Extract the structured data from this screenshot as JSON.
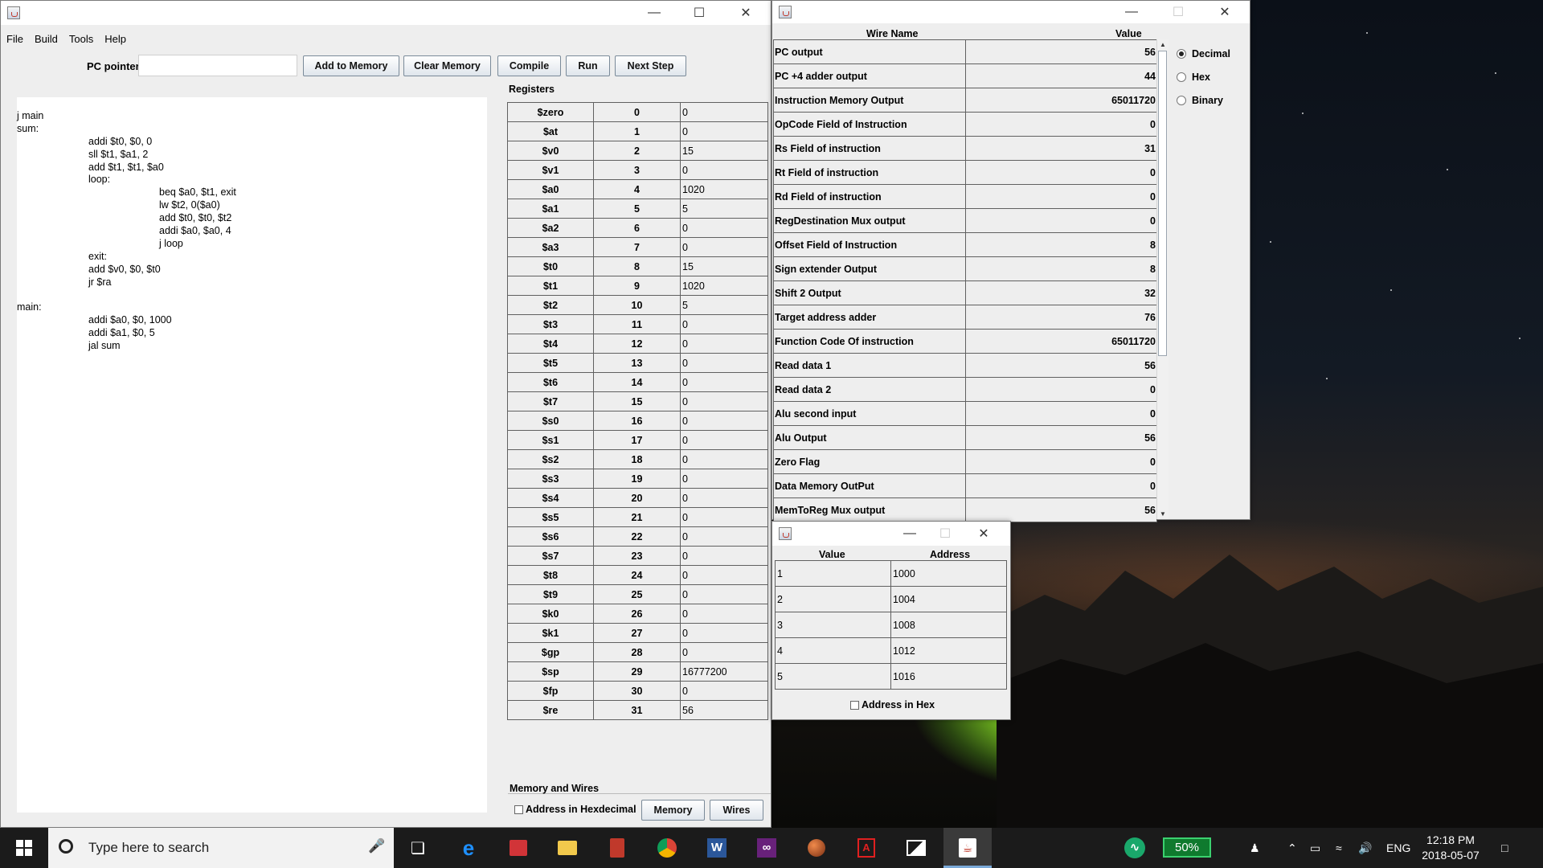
{
  "main_window": {
    "menu": [
      "File",
      "Build",
      "Tools",
      "Help"
    ],
    "pc_pointer_label": "PC pointer",
    "pc_pointer_value": "",
    "buttons": {
      "add_to_memory": "Add to Memory",
      "clear_memory": "Clear Memory",
      "compile": "Compile",
      "run": "Run",
      "next_step": "Next Step"
    },
    "code_lines": [
      {
        "indent": 0,
        "text": "j main"
      },
      {
        "indent": 0,
        "text": "sum:"
      },
      {
        "indent": 1,
        "text": "addi $t0, $0, 0"
      },
      {
        "indent": 1,
        "text": "sll $t1, $a1, 2"
      },
      {
        "indent": 1,
        "text": "add $t1, $t1, $a0"
      },
      {
        "indent": 1,
        "text": "loop:"
      },
      {
        "indent": 2,
        "text": "beq $a0, $t1, exit"
      },
      {
        "indent": 2,
        "text": "lw $t2, 0($a0)"
      },
      {
        "indent": 2,
        "text": "add $t0, $t0, $t2"
      },
      {
        "indent": 2,
        "text": "addi $a0, $a0, 4"
      },
      {
        "indent": 2,
        "text": "j loop"
      },
      {
        "indent": 1,
        "text": "exit:"
      },
      {
        "indent": 1,
        "text": "add $v0, $0, $t0"
      },
      {
        "indent": 1,
        "text": "jr $ra"
      },
      {
        "indent": 0,
        "text": ""
      },
      {
        "indent": 0,
        "text": "main:"
      },
      {
        "indent": 1,
        "text": "addi $a0, $0, 1000"
      },
      {
        "indent": 1,
        "text": "addi $a1, $0, 5"
      },
      {
        "indent": 1,
        "text": "jal sum"
      }
    ],
    "registers_label": "Registers",
    "registers": [
      [
        "$zero",
        "0",
        "0"
      ],
      [
        "$at",
        "1",
        "0"
      ],
      [
        "$v0",
        "2",
        "15"
      ],
      [
        "$v1",
        "3",
        "0"
      ],
      [
        "$a0",
        "4",
        "1020"
      ],
      [
        "$a1",
        "5",
        "5"
      ],
      [
        "$a2",
        "6",
        "0"
      ],
      [
        "$a3",
        "7",
        "0"
      ],
      [
        "$t0",
        "8",
        "15"
      ],
      [
        "$t1",
        "9",
        "1020"
      ],
      [
        "$t2",
        "10",
        "5"
      ],
      [
        "$t3",
        "11",
        "0"
      ],
      [
        "$t4",
        "12",
        "0"
      ],
      [
        "$t5",
        "13",
        "0"
      ],
      [
        "$t6",
        "14",
        "0"
      ],
      [
        "$t7",
        "15",
        "0"
      ],
      [
        "$s0",
        "16",
        "0"
      ],
      [
        "$s1",
        "17",
        "0"
      ],
      [
        "$s2",
        "18",
        "0"
      ],
      [
        "$s3",
        "19",
        "0"
      ],
      [
        "$s4",
        "20",
        "0"
      ],
      [
        "$s5",
        "21",
        "0"
      ],
      [
        "$s6",
        "22",
        "0"
      ],
      [
        "$s7",
        "23",
        "0"
      ],
      [
        "$t8",
        "24",
        "0"
      ],
      [
        "$t9",
        "25",
        "0"
      ],
      [
        "$k0",
        "26",
        "0"
      ],
      [
        "$k1",
        "27",
        "0"
      ],
      [
        "$gp",
        "28",
        "0"
      ],
      [
        "$sp",
        "29",
        "16777200"
      ],
      [
        "$fp",
        "30",
        "0"
      ],
      [
        "$re",
        "31",
        "56"
      ]
    ],
    "memory_wires_label": "Memory and Wires",
    "address_hex_label": "Address in Hexdecimal",
    "memory_button": "Memory",
    "wires_button": "Wires"
  },
  "wires_window": {
    "col_name": "Wire Name",
    "col_value": "Value",
    "rows": [
      [
        "PC output",
        "56"
      ],
      [
        "PC +4 adder output",
        "44"
      ],
      [
        "Instruction Memory Output",
        "65011720"
      ],
      [
        "OpCode Field of Instruction",
        "0"
      ],
      [
        "Rs Field of instruction",
        "31"
      ],
      [
        "Rt Field of instruction",
        "0"
      ],
      [
        "Rd Field of instruction",
        "0"
      ],
      [
        "RegDestination Mux output",
        "0"
      ],
      [
        "Offset Field of Instruction",
        "8"
      ],
      [
        "Sign extender Output",
        "8"
      ],
      [
        "Shift 2 Output",
        "32"
      ],
      [
        "Target address adder",
        "76"
      ],
      [
        "Function Code Of instruction",
        "65011720"
      ],
      [
        "Read data 1",
        "56"
      ],
      [
        "Read data 2",
        "0"
      ],
      [
        "Alu second input",
        "0"
      ],
      [
        "Alu Output",
        "56"
      ],
      [
        "Zero Flag",
        "0"
      ],
      [
        "Data Memory OutPut",
        "0"
      ],
      [
        "MemToReg Mux output",
        "56"
      ]
    ],
    "radio_options": [
      "Decimal",
      "Hex",
      "Binary"
    ],
    "selected_radio": "Decimal"
  },
  "memory_window": {
    "col_value": "Value",
    "col_address": "Address",
    "rows": [
      [
        "1",
        "1000"
      ],
      [
        "2",
        "1004"
      ],
      [
        "3",
        "1008"
      ],
      [
        "4",
        "1012"
      ],
      [
        "5",
        "1016"
      ]
    ],
    "address_hex_label": "Address in Hex"
  },
  "taskbar": {
    "search_placeholder": "Type here to search",
    "battery_percent": "50%",
    "language": "ENG",
    "time": "12:18 PM",
    "date": "2018-05-07"
  },
  "colors": {
    "window_bg": "#eeeeee",
    "taskbar_bg": "#1b1b1b",
    "battery_green": "#0f7a2e"
  }
}
